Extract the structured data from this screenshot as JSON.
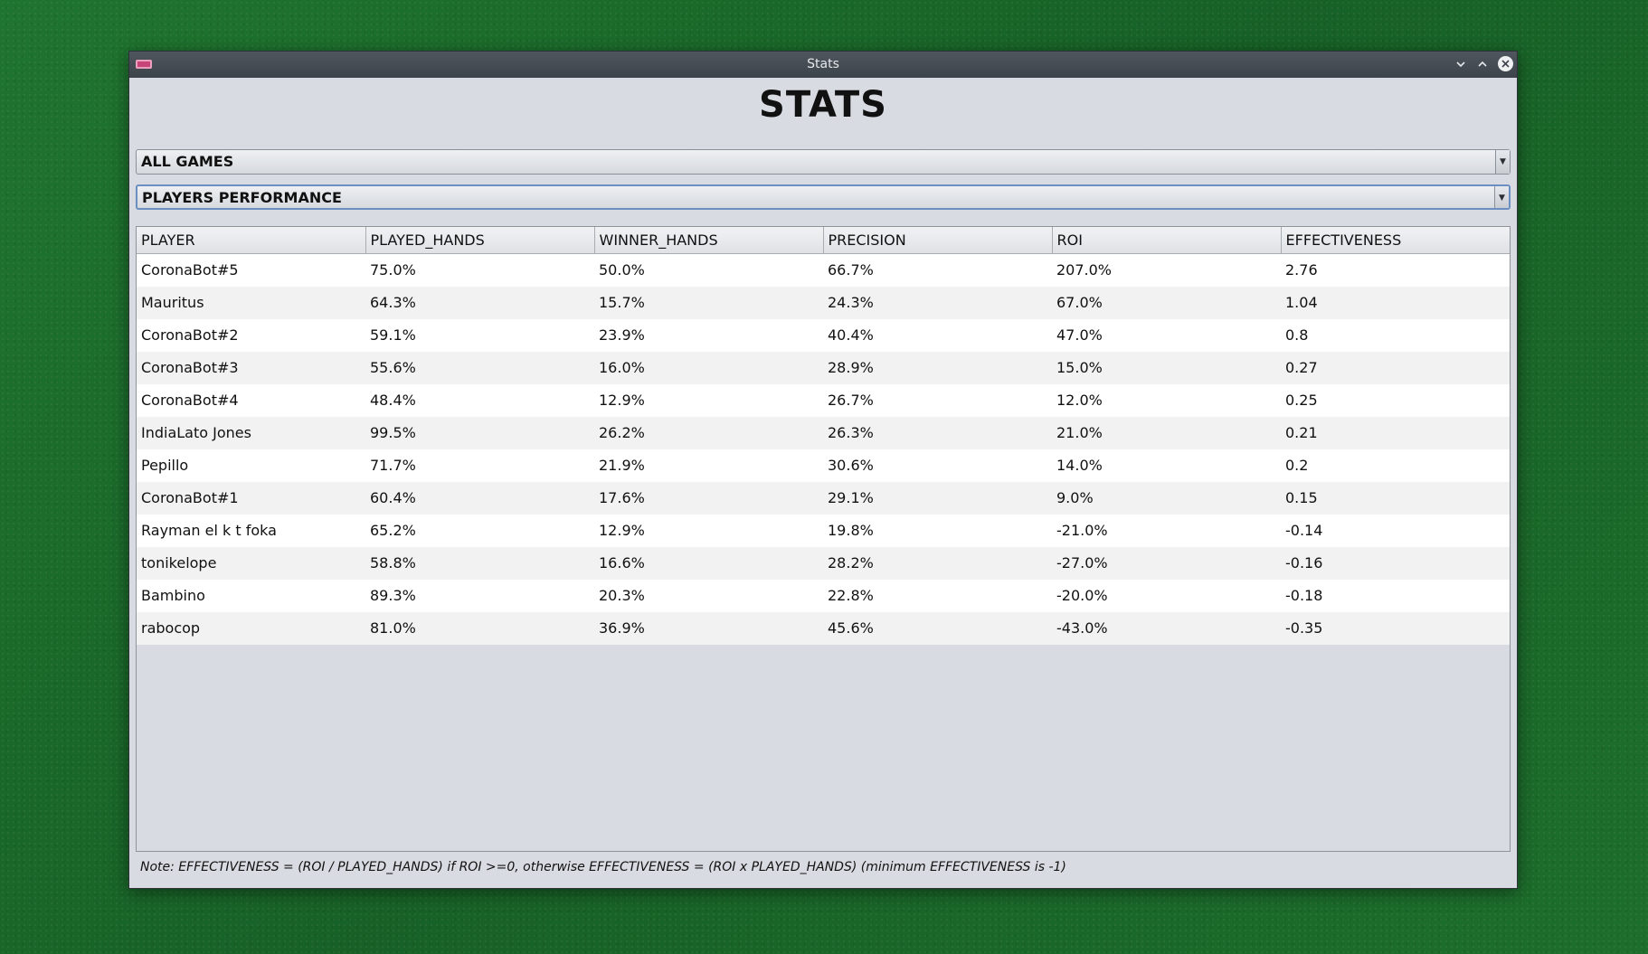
{
  "window": {
    "title": "Stats"
  },
  "heading": "STATS",
  "filters": {
    "game_selector": "ALL GAMES",
    "report_selector": "PLAYERS PERFORMANCE"
  },
  "table": {
    "columns": [
      "PLAYER",
      "PLAYED_HANDS",
      "WINNER_HANDS",
      "PRECISION",
      "ROI",
      "EFFECTIVENESS"
    ],
    "rows": [
      [
        "CoronaBot#5",
        "75.0%",
        "50.0%",
        "66.7%",
        "207.0%",
        "2.76"
      ],
      [
        "Mauritus",
        "64.3%",
        "15.7%",
        "24.3%",
        "67.0%",
        "1.04"
      ],
      [
        "CoronaBot#2",
        "59.1%",
        "23.9%",
        "40.4%",
        "47.0%",
        "0.8"
      ],
      [
        "CoronaBot#3",
        "55.6%",
        "16.0%",
        "28.9%",
        "15.0%",
        "0.27"
      ],
      [
        "CoronaBot#4",
        "48.4%",
        "12.9%",
        "26.7%",
        "12.0%",
        "0.25"
      ],
      [
        "IndiaLato Jones",
        "99.5%",
        "26.2%",
        "26.3%",
        "21.0%",
        "0.21"
      ],
      [
        "Pepillo",
        "71.7%",
        "21.9%",
        "30.6%",
        "14.0%",
        "0.2"
      ],
      [
        "CoronaBot#1",
        "60.4%",
        "17.6%",
        "29.1%",
        "9.0%",
        "0.15"
      ],
      [
        "Rayman el k t foka",
        "65.2%",
        "12.9%",
        "19.8%",
        "-21.0%",
        "-0.14"
      ],
      [
        "tonikelope",
        "58.8%",
        "16.6%",
        "28.2%",
        "-27.0%",
        "-0.16"
      ],
      [
        "Bambino",
        "89.3%",
        "20.3%",
        "22.8%",
        "-20.0%",
        "-0.18"
      ],
      [
        "rabocop",
        "81.0%",
        "36.9%",
        "45.6%",
        "-43.0%",
        "-0.35"
      ]
    ]
  },
  "note": "Note: EFFECTIVENESS = (ROI / PLAYED_HANDS) if ROI >=0, otherwise EFFECTIVENESS = (ROI x PLAYED_HANDS) (minimum EFFECTIVENESS is -1)",
  "icons": {
    "app": "app-icon",
    "minimize": "chevron-down-icon",
    "maximize": "chevron-up-icon",
    "close": "close-icon"
  }
}
